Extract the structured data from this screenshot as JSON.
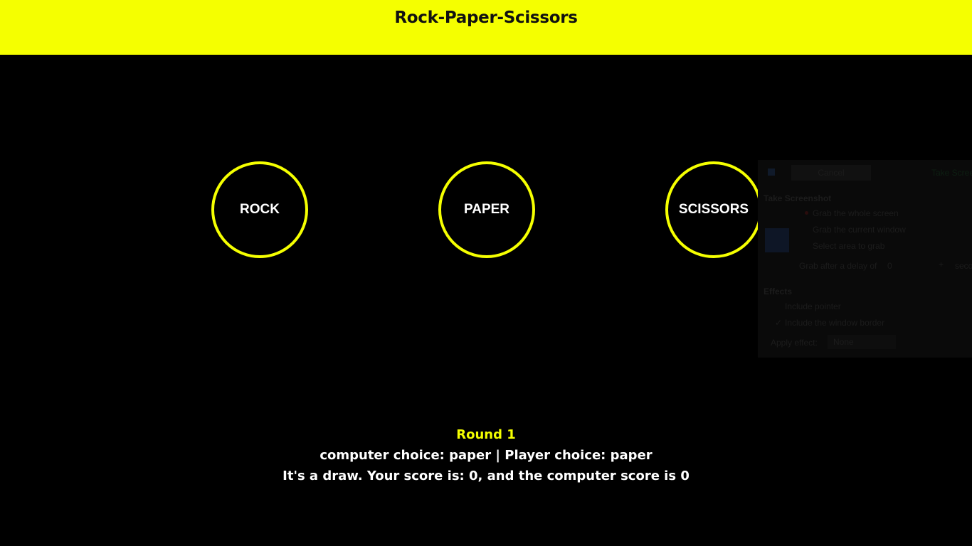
{
  "header": {
    "title": "Rock-Paper-Scissors"
  },
  "choices": {
    "rock": "ROCK",
    "paper": "PAPER",
    "scissors": "SCISSORS"
  },
  "status": {
    "round": "Round 1",
    "choices_line": "computer choice: paper | Player choice: paper",
    "result_line": "It's a draw. Your score is: 0, and the computer score is 0"
  },
  "screenshot_dialog": {
    "cancel_label": "Cancel",
    "take_label": "Take Scree",
    "section_title": "Take Screenshot",
    "options": [
      "Grab the whole screen",
      "Grab the current window",
      "Select area to grab"
    ],
    "delay_label": "Grab after a delay of",
    "delay_value": "0",
    "plus_label": "+",
    "seconds_label": "seco",
    "effects_title": "Effects",
    "effects": [
      "Include pointer",
      "Include the window border"
    ],
    "apply_effect_label": "Apply effect:",
    "apply_effect_value": "None"
  },
  "colors": {
    "accent": "#f5ff00",
    "background": "#000000",
    "text": "#ffffff"
  }
}
